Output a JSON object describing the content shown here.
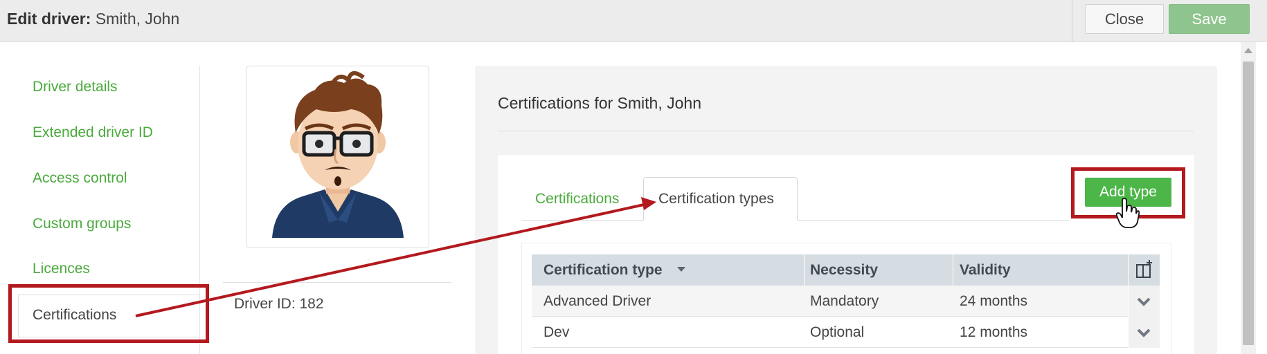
{
  "header": {
    "title_bold": "Edit driver:",
    "title_name": "Smith, John",
    "close_label": "Close",
    "save_label": "Save"
  },
  "sidebar": {
    "items": [
      {
        "label": "Driver details"
      },
      {
        "label": "Extended driver ID"
      },
      {
        "label": "Access control"
      },
      {
        "label": "Custom groups"
      },
      {
        "label": "Licences"
      },
      {
        "label": "Certifications",
        "active": true
      }
    ]
  },
  "driver": {
    "id_label": "Driver ID: 182"
  },
  "certifications": {
    "title": "Certifications for Smith, John",
    "tabs": [
      {
        "label": "Certifications",
        "active": false
      },
      {
        "label": "Certification types",
        "active": true
      }
    ],
    "add_type_label": "Add type",
    "table": {
      "columns": [
        "Certification type",
        "Necessity",
        "Validity"
      ],
      "rows": [
        [
          "Advanced Driver",
          "Mandatory",
          "24 months"
        ],
        [
          "Dev",
          "Optional",
          "12 months"
        ]
      ]
    }
  },
  "colors": {
    "accent_green": "#4aaa3c",
    "button_green": "#4cb648",
    "save_disabled_green": "#8ec48e",
    "annotation_red": "#b3191e",
    "table_header": "#d5dce2"
  },
  "icons": {
    "column_picker": "column-add-icon",
    "row_expand": "chevron-down-icon",
    "cursor": "hand-pointer-icon",
    "scroll_up": "triangle-up-icon"
  }
}
